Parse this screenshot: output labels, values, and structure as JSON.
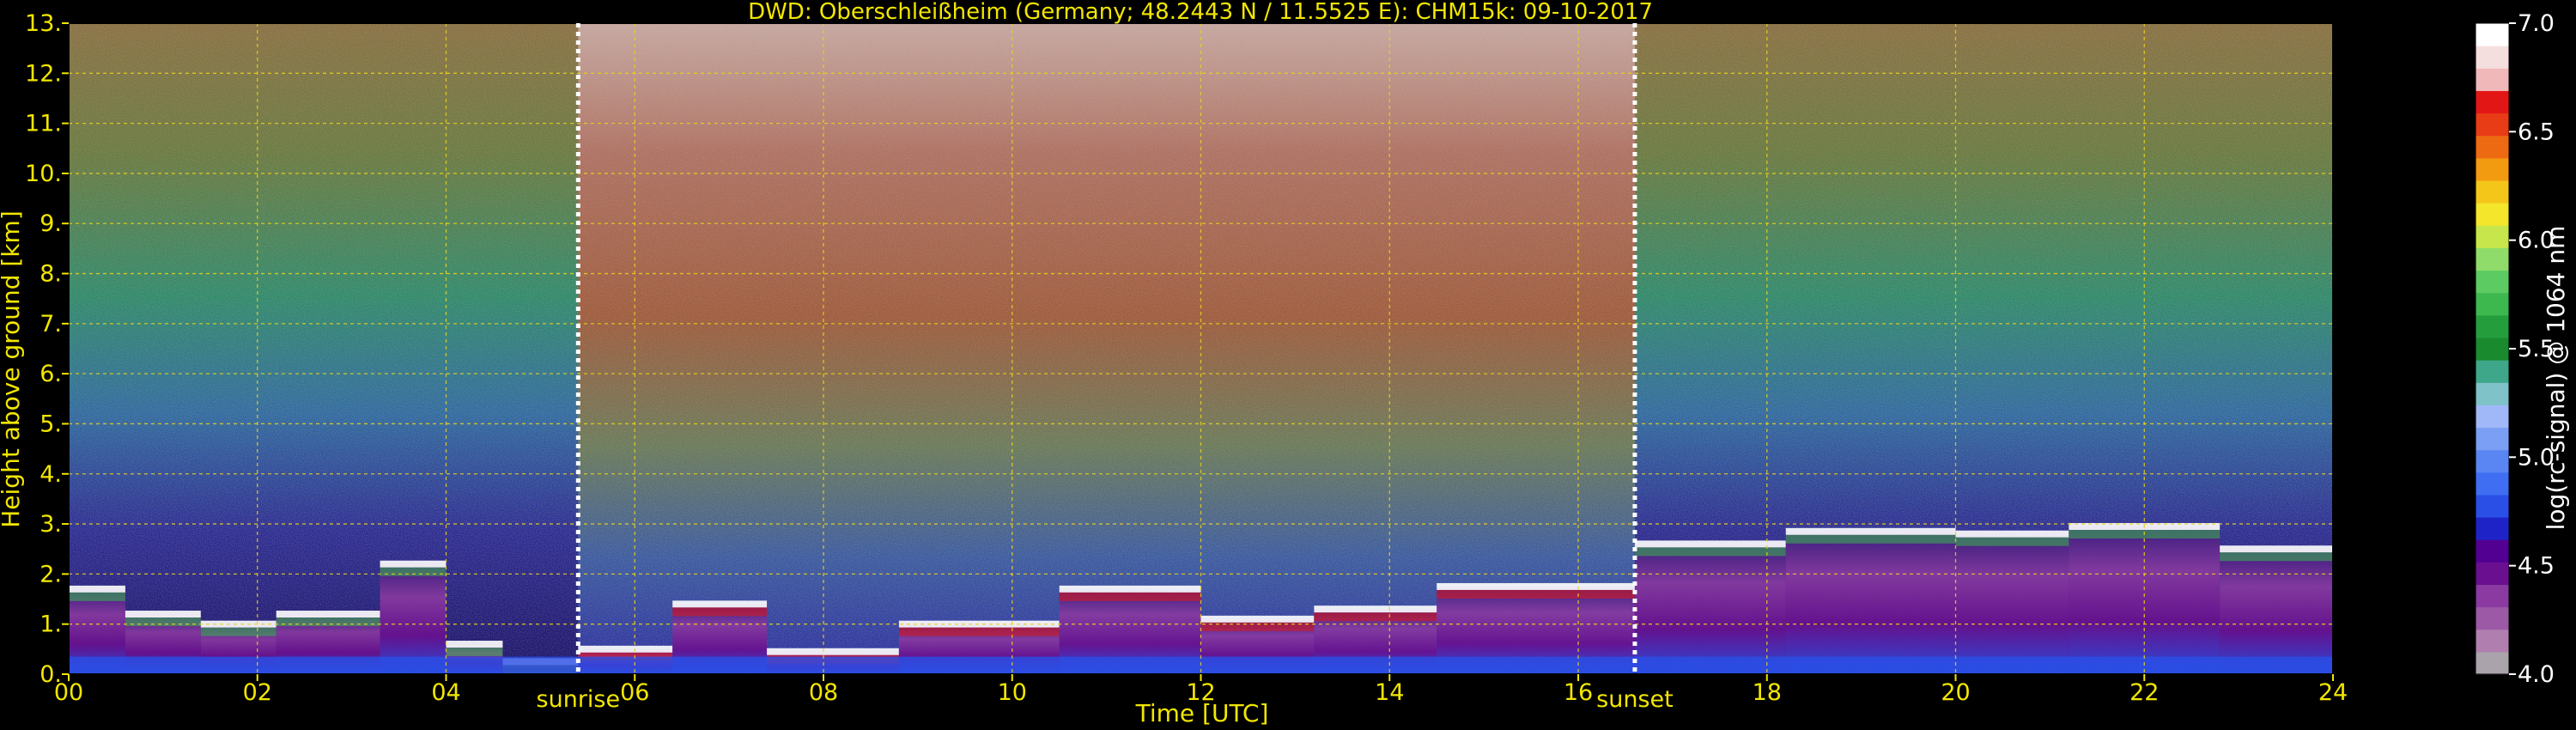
{
  "chart_data": {
    "type": "heatmap",
    "title": "DWD: Oberschleißheim (Germany; 48.2443 N / 11.5525 E):    CHM15k: 09-10-2017",
    "xlabel": "Time [UTC]",
    "ylabel": "Height above ground [km]",
    "xlim": [
      0,
      24
    ],
    "ylim": [
      0,
      13
    ],
    "x_ticks": [
      "00",
      "02",
      "04",
      "06",
      "08",
      "10",
      "12",
      "14",
      "16",
      "18",
      "20",
      "22",
      "24"
    ],
    "y_ticks": [
      "0.",
      "1.",
      "2.",
      "3.",
      "4.",
      "5.",
      "6.",
      "7.",
      "8.",
      "9.",
      "10.",
      "11.",
      "12.",
      "13."
    ],
    "grid": true,
    "markers": [
      {
        "label": "sunrise",
        "x": 5.4
      },
      {
        "label": "sunset",
        "x": 16.6
      }
    ],
    "colorbar": {
      "label": "log(rc-signal) @ 1064 nm",
      "range": [
        4.0,
        7.0
      ],
      "ticks": [
        "4.0",
        "4.5",
        "5.0",
        "5.5",
        "6.0",
        "6.5",
        "7.0"
      ],
      "colors": [
        "#aaa3ab",
        "#b07fb0",
        "#9c5aa6",
        "#8a3aa0",
        "#6a0f8f",
        "#520092",
        "#1e23c8",
        "#2a4fe6",
        "#3f6ef2",
        "#5a86f4",
        "#7c9ff6",
        "#a0b8f8",
        "#7fc2c8",
        "#3ea78a",
        "#1a8a2e",
        "#249e3c",
        "#3cb84f",
        "#5ccc62",
        "#8fdc6a",
        "#c6e64c",
        "#f4e62a",
        "#f5c61a",
        "#f29a10",
        "#ee6a12",
        "#e83c16",
        "#e31616",
        "#f0b8b8",
        "#f4dede",
        "#ffffff"
      ]
    },
    "regimes": [
      {
        "x": [
          0,
          5.4
        ],
        "clouds": [
          [
            0.0,
            0.6,
            1.7
          ],
          [
            0.6,
            1.4,
            1.2
          ],
          [
            1.4,
            2.2,
            1.0
          ],
          [
            2.2,
            3.3,
            1.2
          ],
          [
            3.3,
            4.0,
            2.2
          ],
          [
            4.0,
            4.6,
            0.6
          ],
          [
            4.6,
            5.4,
            0.25
          ]
        ]
      },
      {
        "x": [
          5.4,
          16.6
        ],
        "clouds": [
          [
            5.4,
            6.4,
            0.5
          ],
          [
            6.4,
            7.4,
            1.4
          ],
          [
            7.4,
            8.8,
            0.45
          ],
          [
            8.8,
            10.5,
            1.0
          ],
          [
            10.5,
            12.0,
            1.7
          ],
          [
            12.0,
            13.2,
            1.1
          ],
          [
            13.2,
            14.5,
            1.3
          ],
          [
            14.5,
            16.6,
            1.75
          ]
        ]
      },
      {
        "x": [
          16.6,
          24
        ],
        "clouds": [
          [
            16.6,
            18.2,
            2.6
          ],
          [
            18.2,
            20.0,
            2.85
          ],
          [
            20.0,
            21.2,
            2.8
          ],
          [
            21.2,
            22.8,
            2.95
          ],
          [
            22.8,
            24.0,
            2.5
          ]
        ]
      }
    ]
  }
}
